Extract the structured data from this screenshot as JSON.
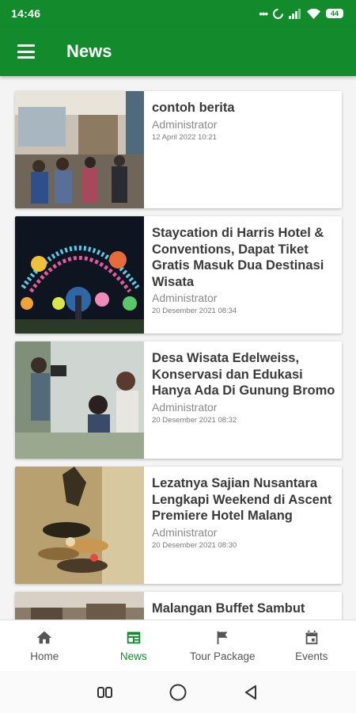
{
  "status": {
    "time": "14:46",
    "battery": "44"
  },
  "appbar": {
    "title": "News"
  },
  "news": [
    {
      "title": "contoh berita",
      "author": "Administrator",
      "date": "12 April 2022 10:21"
    },
    {
      "title": "Staycation di Harris Hotel & Conventions, Dapat Tiket Gratis Masuk Dua Destinasi Wisata",
      "author": "Administrator",
      "date": "20 Desember 2021 08:34"
    },
    {
      "title": "Desa Wisata Edelweiss, Konservasi dan Edukasi Hanya Ada Di Gunung Bromo",
      "author": "Administrator",
      "date": "20 Desember 2021 08:32"
    },
    {
      "title": "Lezatnya Sajian Nusantara Lengkapi Weekend di Ascent Premiere Hotel Malang",
      "author": "Administrator",
      "date": "20 Desember 2021 08:30"
    },
    {
      "title": "Malangan Buffet Sambut",
      "author": "",
      "date": ""
    }
  ],
  "bottom_nav": [
    {
      "label": "Home",
      "icon": "home-icon"
    },
    {
      "label": "News",
      "icon": "news-icon"
    },
    {
      "label": "Tour Package",
      "icon": "flag-icon"
    },
    {
      "label": "Events",
      "icon": "calendar-icon"
    }
  ],
  "colors": {
    "primary": "#138a2b",
    "text": "#3a3a3a",
    "muted": "#8a8a8a"
  }
}
